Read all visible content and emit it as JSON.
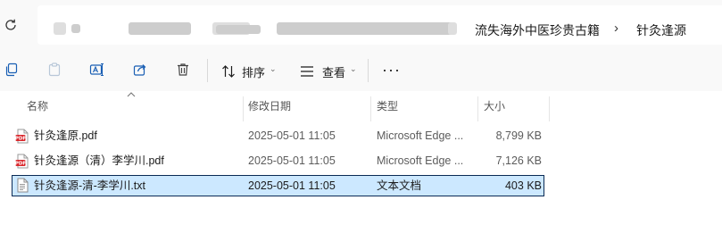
{
  "breadcrumb": {
    "items": [
      "流失海外中医珍贵古籍",
      "针灸逢源"
    ],
    "separator": "›"
  },
  "toolbar": {
    "sort_label": "排序",
    "view_label": "查看",
    "more_label": "···"
  },
  "columns": {
    "name": "名称",
    "date": "修改日期",
    "type": "类型",
    "size": "大小"
  },
  "files": [
    {
      "name": "针灸逢原.pdf",
      "date": "2025-05-01 11:05",
      "type": "Microsoft Edge ...",
      "size": "8,799 KB",
      "icon": "pdf-icon",
      "selected": false
    },
    {
      "name": "针灸逢源（清）李学川.pdf",
      "date": "2025-05-01 11:05",
      "type": "Microsoft Edge ...",
      "size": "7,126 KB",
      "icon": "pdf-icon",
      "selected": false
    },
    {
      "name": "针灸逢源-清-李学川.txt",
      "date": "2025-05-01 11:05",
      "type": "文本文档",
      "size": "403 KB",
      "icon": "text-file-icon",
      "selected": true
    }
  ],
  "colors": {
    "selection_bg": "#cce8ff",
    "selection_border": "#0a2a55",
    "pdf_red": "#d9262b"
  }
}
